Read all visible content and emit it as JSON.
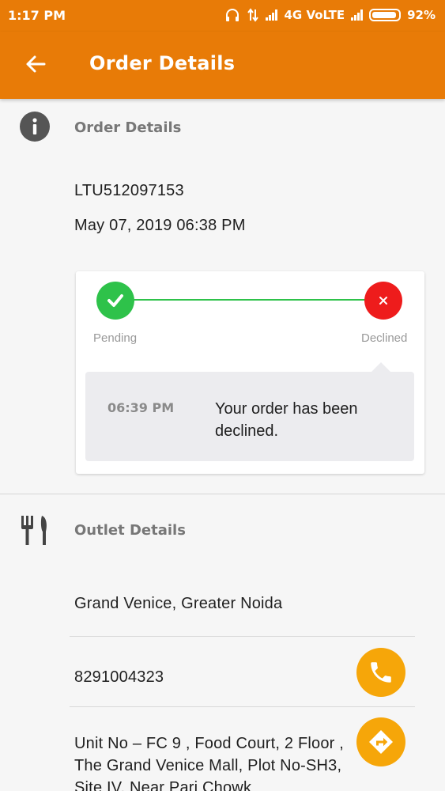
{
  "status_bar": {
    "time": "1:17 PM",
    "network": "4G VoLTE",
    "battery": "92%"
  },
  "app_bar": {
    "title": "Order Details"
  },
  "order_section": {
    "title": "Order Details",
    "order_id": "LTU512097153",
    "datetime": "May 07, 2019 06:38 PM",
    "steps": [
      {
        "label": "Pending",
        "status": "done",
        "color": "#2ec24a"
      },
      {
        "label": "Declined",
        "status": "declined",
        "color": "#ee1c1c"
      }
    ],
    "message": {
      "time": "06:39 PM",
      "text": "Your order has been declined."
    }
  },
  "outlet_section": {
    "title": "Outlet Details",
    "name": "Grand Venice, Greater Noida",
    "phone": "8291004323",
    "address": "Unit No – FC 9 , Food Court, 2 Floor , The Grand Venice Mall, Plot No-SH3, Site IV, Near Pari Chowk"
  },
  "colors": {
    "primary": "#e87b07",
    "fab": "#f6a609",
    "success": "#2ec24a",
    "error": "#ee1c1c"
  },
  "icons": [
    "back-arrow-icon",
    "info-icon",
    "cutlery-icon",
    "phone-icon",
    "directions-icon",
    "check-icon",
    "cross-icon"
  ]
}
